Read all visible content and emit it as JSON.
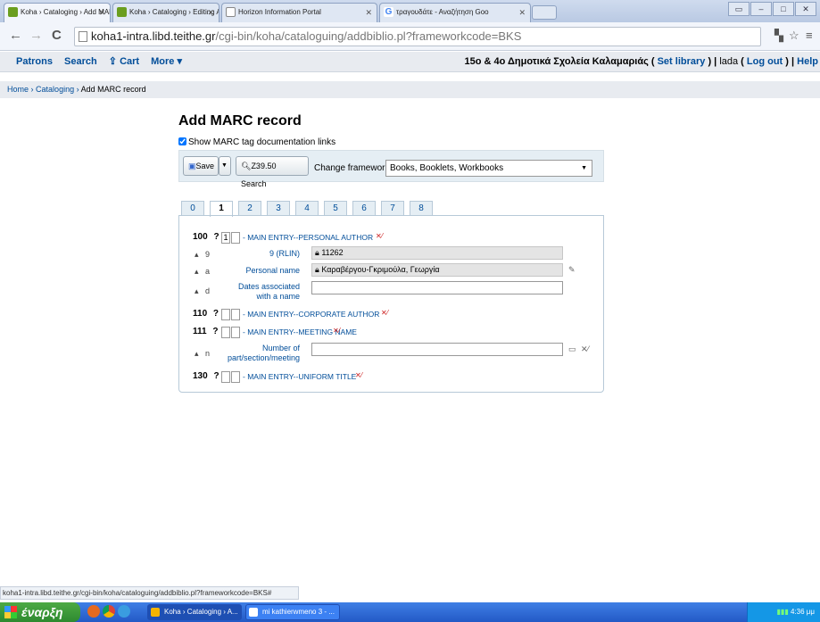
{
  "browser": {
    "tabs": [
      {
        "title": "Koha › Cataloging › Add MAR",
        "color": "#6b9e1f"
      },
      {
        "title": "Koha › Cataloging › Editing A",
        "color": "#6b9e1f"
      },
      {
        "title": "Horizon Information Portal",
        "color": "#ffffff"
      },
      {
        "title": "τραγουδάτε - Αναζήτηση Goo",
        "color": "#4285f4"
      }
    ],
    "url_host": "koha1-intra.libd.teithe.gr",
    "url_path": "/cgi-bin/koha/cataloguing/addbiblio.pl?frameworkcode=BKS"
  },
  "kohanav": {
    "patrons": "Patrons",
    "search": "Search",
    "cart": "⇪ Cart",
    "more": "More ▾",
    "library_name": "15ο & 4ο Δημοτικά Σχολεία Καλαμαριάς",
    "set_library": "Set library",
    "user": "lada",
    "logout": "Log out",
    "help": "Help"
  },
  "breadcrumb": {
    "home": "Home",
    "cataloging": "Cataloging",
    "current": "Add MARC record",
    "sep": "›"
  },
  "page": {
    "title": "Add MARC record",
    "show_doc_label": "Show MARC tag documentation links",
    "save_label": "Save",
    "z3950_label": "Z39.50 Search",
    "framework_label": "Change framework:",
    "framework_value": "Books, Booklets, Workbooks"
  },
  "marc_tabs": [
    "0",
    "1",
    "2",
    "3",
    "4",
    "5",
    "6",
    "7",
    "8"
  ],
  "fields": {
    "f100": {
      "tag": "100",
      "q": "?",
      "ind1": "1",
      "ind2": "",
      "desc": "- MAIN ENTRY--PERSONAL AUTHOR"
    },
    "s9": {
      "code": "9",
      "label": "9 (RLIN)",
      "value": "11262"
    },
    "sa": {
      "code": "a",
      "label": "Personal name",
      "value": "Καραβέργου-Γκριμούλα, Γεωργία"
    },
    "sd": {
      "code": "d",
      "label1": "Dates associated",
      "label2": "with a name",
      "value": ""
    },
    "f110": {
      "tag": "110",
      "q": "?",
      "desc": "- MAIN ENTRY--CORPORATE AUTHOR"
    },
    "f111": {
      "tag": "111",
      "q": "?",
      "desc": "- MAIN ENTRY--MEETING NAME"
    },
    "sn": {
      "code": "n",
      "label1": "Number of",
      "label2": "part/section/meeting",
      "value": ""
    },
    "f130": {
      "tag": "130",
      "q": "?",
      "desc": "- MAIN ENTRY--UNIFORM TITLE"
    }
  },
  "statusbar": "koha1-intra.libd.teithe.gr/cgi-bin/koha/cataloguing/addbiblio.pl?frameworkcode=BKS#",
  "taskbar": {
    "start": "έναρξη",
    "items": [
      "Koha › Cataloging › A...",
      "mi kathierwmeno 3 - ..."
    ],
    "clock": "4:36 μμ"
  }
}
